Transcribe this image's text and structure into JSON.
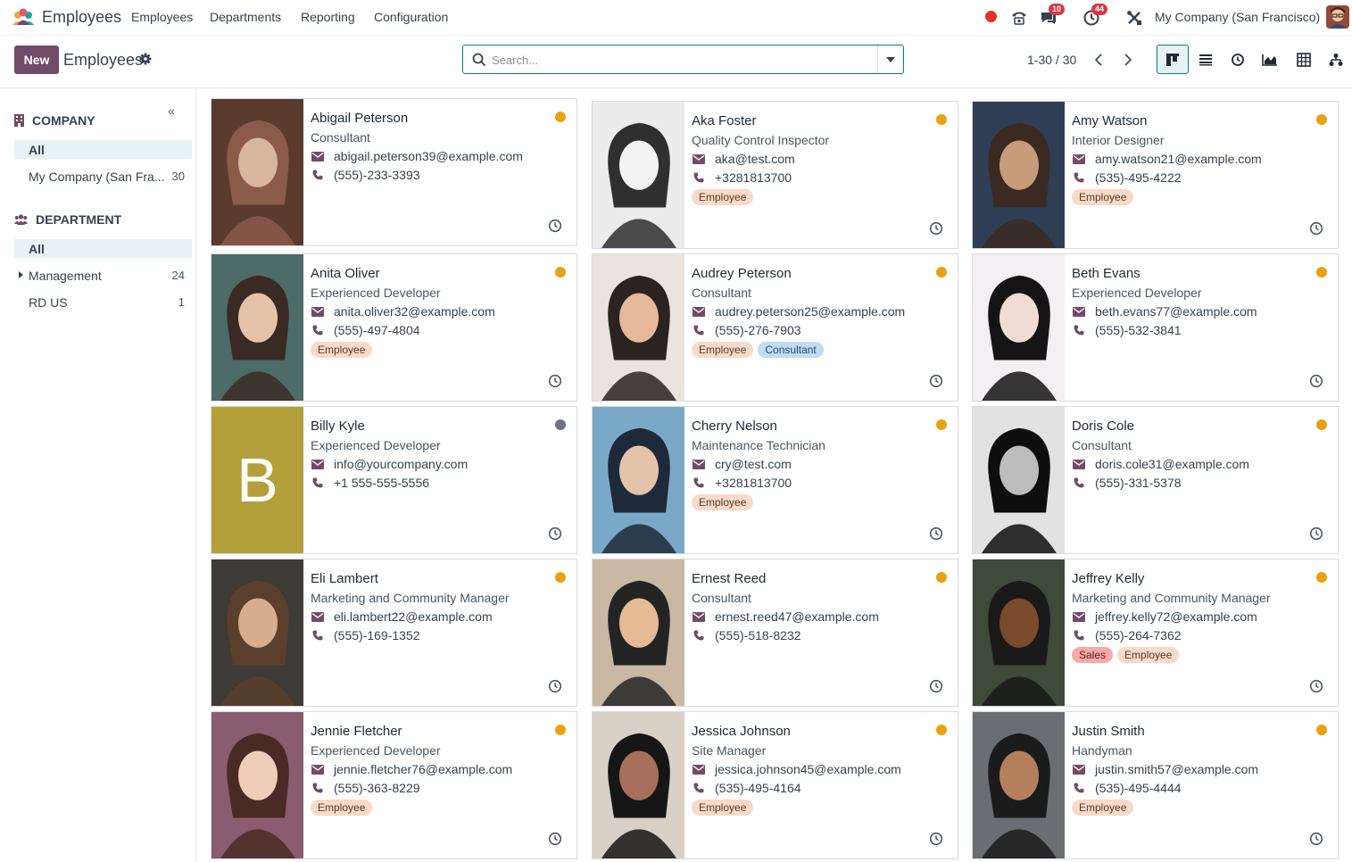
{
  "navbar": {
    "app_name": "Employees",
    "menu": [
      "Employees",
      "Departments",
      "Reporting",
      "Configuration"
    ],
    "chat_badge": "10",
    "activity_badge": "44",
    "company": "My Company (San Francisco)"
  },
  "control_panel": {
    "new_label": "New",
    "title": "Employees",
    "search_placeholder": "Search...",
    "pager": "1-30 / 30"
  },
  "sidebar": {
    "company_title": "COMPANY",
    "company_items": [
      {
        "label": "All",
        "count": ""
      },
      {
        "label": "My Company (San Fra...",
        "count": "30"
      }
    ],
    "department_title": "DEPARTMENT",
    "department_items": [
      {
        "label": "All",
        "count": ""
      },
      {
        "label": "Management",
        "count": "24"
      },
      {
        "label": "RD US",
        "count": "1"
      }
    ]
  },
  "employees": [
    {
      "name": "Abigail Peterson",
      "job": "Consultant",
      "email": "abigail.peterson39@example.com",
      "phone": "(555)-233-3393",
      "tags": []
    },
    {
      "name": "Aka Foster",
      "job": "Quality Control Inspector",
      "email": "aka@test.com",
      "phone": "+3281813700",
      "tags": [
        "Employee"
      ]
    },
    {
      "name": "Amy Watson",
      "job": "Interior Designer",
      "email": "amy.watson21@example.com",
      "phone": "(535)-495-4222",
      "tags": [
        "Employee"
      ]
    },
    {
      "name": "Anita Oliver",
      "job": "Experienced Developer",
      "email": "anita.oliver32@example.com",
      "phone": "(555)-497-4804",
      "tags": [
        "Employee"
      ]
    },
    {
      "name": "Audrey Peterson",
      "job": "Consultant",
      "email": "audrey.peterson25@example.com",
      "phone": "(555)-276-7903",
      "tags": [
        "Employee",
        "Consultant"
      ]
    },
    {
      "name": "Beth Evans",
      "job": "Experienced Developer",
      "email": "beth.evans77@example.com",
      "phone": "(555)-532-3841",
      "tags": []
    },
    {
      "name": "Billy Kyle",
      "job": "Experienced Developer",
      "email": "info@yourcompany.com",
      "phone": "+1 555-555-5556",
      "tags": [],
      "monogram": "B"
    },
    {
      "name": "Cherry Nelson",
      "job": "Maintenance Technician",
      "email": "cry@test.com",
      "phone": "+3281813700",
      "tags": [
        "Employee"
      ]
    },
    {
      "name": "Doris Cole",
      "job": "Consultant",
      "email": "doris.cole31@example.com",
      "phone": "(555)-331-5378",
      "tags": []
    },
    {
      "name": "Eli Lambert",
      "job": "Marketing and Community Manager",
      "email": "eli.lambert22@example.com",
      "phone": "(555)-169-1352",
      "tags": []
    },
    {
      "name": "Ernest Reed",
      "job": "Consultant",
      "email": "ernest.reed47@example.com",
      "phone": "(555)-518-8232",
      "tags": []
    },
    {
      "name": "Jeffrey Kelly",
      "job": "Marketing and Community Manager",
      "email": "jeffrey.kelly72@example.com",
      "phone": "(555)-264-7362",
      "tags": [
        "Sales",
        "Employee"
      ]
    },
    {
      "name": "Jennie Fletcher",
      "job": "Experienced Developer",
      "email": "jennie.fletcher76@example.com",
      "phone": "(555)-363-8229",
      "tags": [
        "Employee"
      ]
    },
    {
      "name": "Jessica Johnson",
      "job": "Site Manager",
      "email": "jessica.johnson45@example.com",
      "phone": "(535)-495-4164",
      "tags": [
        "Employee"
      ]
    },
    {
      "name": "Justin Smith",
      "job": "Handyman",
      "email": "justin.smith57@example.com",
      "phone": "(535)-495-4444",
      "tags": [
        "Employee"
      ]
    }
  ],
  "colors": {
    "primary": "#714b67",
    "accent": "#017e84",
    "status_online": "#e9a20d",
    "status_offline": "#6b7280"
  }
}
